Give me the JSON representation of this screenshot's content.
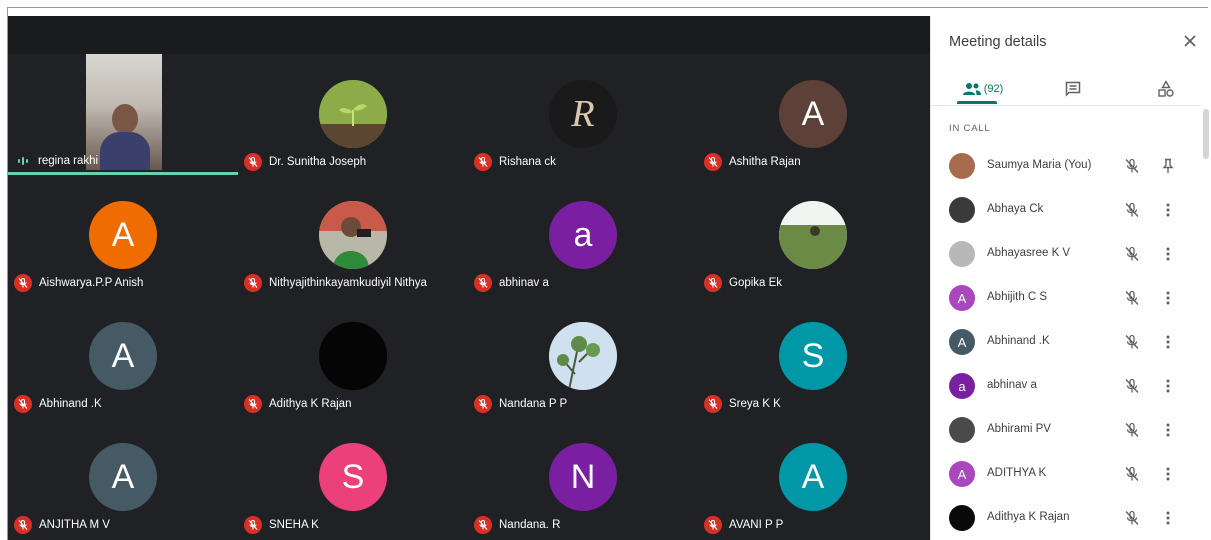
{
  "window": {
    "accent": "#00796b"
  },
  "grid": {
    "tiles": [
      {
        "name": "regina rakhi",
        "type": "video",
        "speaking": true
      },
      {
        "name": "Dr. Sunitha Joseph",
        "type": "photo",
        "photo": "plant-sprout",
        "color": "#6b8f3a"
      },
      {
        "name": "Rishana ck",
        "type": "photo",
        "photo": "letter-r-logo",
        "color": "#1c1c1c"
      },
      {
        "name": "Ashitha Rajan",
        "type": "letter",
        "letter": "A",
        "color": "#5d4037"
      },
      {
        "name": "Aishwarya.P.P Anish",
        "type": "letter",
        "letter": "A",
        "color": "#ef6c00"
      },
      {
        "name": "Nithyajithinkayamkudiyil Nithya",
        "type": "photo",
        "photo": "person-photo",
        "color": "#6f8f5a"
      },
      {
        "name": "abhinav a",
        "type": "letter",
        "letter": "a",
        "color": "#7b1fa2"
      },
      {
        "name": "Gopika Ek",
        "type": "photo",
        "photo": "field-landscape",
        "color": "#6e8a4a"
      },
      {
        "name": "Abhinand .K",
        "type": "letter",
        "letter": "A",
        "color": "#455a64"
      },
      {
        "name": "Adithya K Rajan",
        "type": "photo",
        "photo": "black-circle",
        "color": "#0a0a0a"
      },
      {
        "name": "Nandana P P",
        "type": "photo",
        "photo": "tree-sky",
        "color": "#8fb0c8"
      },
      {
        "name": "Sreya K K",
        "type": "letter",
        "letter": "S",
        "color": "#0097a7"
      },
      {
        "name": "ANJITHA M V",
        "type": "letter",
        "letter": "A",
        "color": "#455a64"
      },
      {
        "name": "SNEHA K",
        "type": "letter",
        "letter": "S",
        "color": "#ec407a"
      },
      {
        "name": "Nandana. R",
        "type": "letter",
        "letter": "N",
        "color": "#7b1fa2"
      },
      {
        "name": "AVANI P P",
        "type": "letter",
        "letter": "A",
        "color": "#0097a7"
      }
    ]
  },
  "sidebar": {
    "title": "Meeting details",
    "tabs": {
      "people_count": "(92)"
    },
    "section_label": "IN CALL",
    "participants": [
      {
        "name": "Saumya Maria (You)",
        "avatar": "photo",
        "color": "#a86b4e",
        "action": "pin-icon"
      },
      {
        "name": "Abhaya Ck",
        "avatar": "photo",
        "color": "#3a3a3a",
        "action": "more-vert-icon"
      },
      {
        "name": "Abhayasree K V",
        "avatar": "photo",
        "color": "#b8b8b8",
        "action": "more-vert-icon"
      },
      {
        "name": "Abhijith C S",
        "avatar": "letter",
        "letter": "A",
        "color": "#ab47bc",
        "action": "more-vert-icon"
      },
      {
        "name": "Abhinand .K",
        "avatar": "letter",
        "letter": "A",
        "color": "#455a64",
        "action": "more-vert-icon"
      },
      {
        "name": "abhinav a",
        "avatar": "letter",
        "letter": "a",
        "color": "#7b1fa2",
        "action": "more-vert-icon"
      },
      {
        "name": "Abhirami PV",
        "avatar": "photo",
        "color": "#4a4a4a",
        "action": "more-vert-icon"
      },
      {
        "name": "ADITHYA K",
        "avatar": "letter",
        "letter": "A",
        "color": "#ab47bc",
        "action": "more-vert-icon"
      },
      {
        "name": "Adithya K Rajan",
        "avatar": "photo",
        "color": "#0a0a0a",
        "action": "more-vert-icon"
      }
    ]
  }
}
